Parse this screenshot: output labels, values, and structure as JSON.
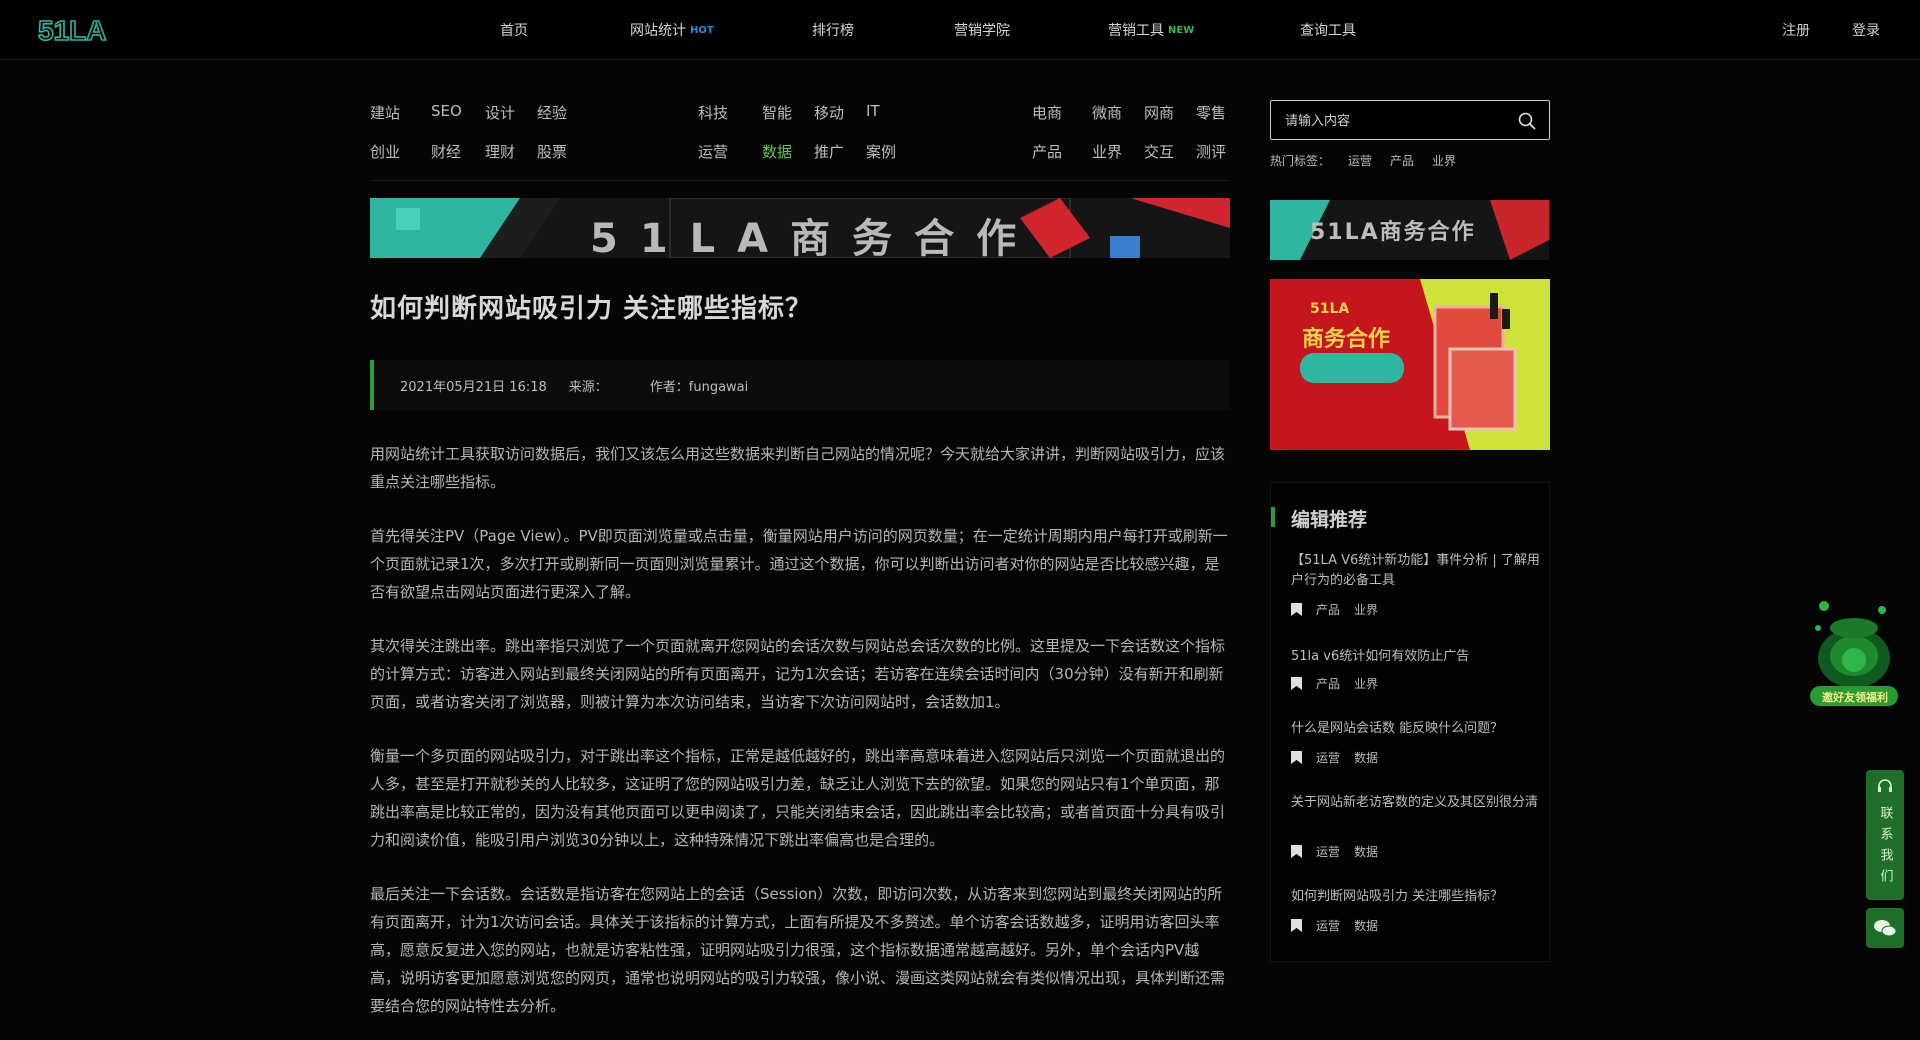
{
  "header": {
    "logo_text": "51LA",
    "nav": [
      {
        "label": "首页",
        "badge": ""
      },
      {
        "label": "网站统计",
        "badge": "HOT"
      },
      {
        "label": "排行榜",
        "badge": ""
      },
      {
        "label": "营销学院",
        "badge": ""
      },
      {
        "label": "营销工具",
        "badge": "NEW"
      },
      {
        "label": "查询工具",
        "badge": ""
      }
    ],
    "register": "注册",
    "login": "登录"
  },
  "categories": {
    "group1_row1": [
      "建站",
      "SEO",
      "设计",
      "经验"
    ],
    "group1_row2": [
      "创业",
      "财经",
      "理财",
      "股票"
    ],
    "group2_row1": [
      "科技",
      "智能",
      "移动",
      "IT"
    ],
    "group2_row2": [
      "运营",
      "数据",
      "推广",
      "案例"
    ],
    "group3_row1": [
      "电商",
      "微商",
      "网商",
      "零售"
    ],
    "group3_row2": [
      "产品",
      "业界",
      "交互",
      "测评"
    ]
  },
  "banner": {
    "text": "51LA商务合作"
  },
  "side_banner1": {
    "text": "51LA商务合作"
  },
  "side_banner2": {
    "logo": "51LA",
    "title": "商务合作"
  },
  "article": {
    "title": "如何判断网站吸引力 关注哪些指标？",
    "date": "2021年05月21日 16:18",
    "source_label": "来源：",
    "author": "作者：fungawai",
    "paragraphs": [
      "用网站统计工具获取访问数据后，我们又该怎么用这些数据来判断自己网站的情况呢？今天就给大家讲讲，判断网站吸引力，应该重点关注哪些指标。",
      "首先得关注PV（Page View）。PV即页面浏览量或点击量，衡量网站用户访问的网页数量；在一定统计周期内用户每打开或刷新一个页面就记录1次，多次打开或刷新同一页面则浏览量累计。通过这个数据，你可以判断出访问者对你的网站是否比较感兴趣，是否有欲望点击网站页面进行更深入了解。",
      "其次得关注跳出率。跳出率指只浏览了一个页面就离开您网站的会话次数与网站总会话次数的比例。这里提及一下会话数这个指标的计算方式：访客进入网站到最终关闭网站的所有页面离开，记为1次会话；若访客在连续会话时间内（30分钟）没有新开和刷新页面，或者访客关闭了浏览器，则被计算为本次访问结束，当访客下次访问网站时，会话数加1。",
      "衡量一个多页面的网站吸引力，对于跳出率这个指标，正常是越低越好的，跳出率高意味着进入您网站后只浏览一个页面就退出的人多，甚至是打开就秒关的人比较多，这证明了您的网站吸引力差，缺乏让人浏览下去的欲望。如果您的网站只有1个单页面，那跳出率高是比较正常的，因为没有其他页面可以更申阅读了，只能关闭结束会话，因此跳出率会比较高；或者首页面十分具有吸引力和阅读价值，能吸引用户浏览30分钟以上，这种特殊情况下跳出率偏高也是合理的。",
      "最后关注一下会话数。会话数是指访客在您网站上的会话（Session）次数，即访问次数，从访客来到您网站到最终关闭网站的所有页面离开，计为1次访问会话。具体关于该指标的计算方式，上面有所提及不多赘述。单个访客会话数越多，证明用访客回头率高，愿意反复进入您的网站，也就是访客粘性强，证明网站吸引力很强，这个指标数据通常越高越好。另外，单个会话内PV越高，说明访客更加愿意浏览您的网页，通常也说明网站的吸引力较强，像小说、漫画这类网站就会有类似情况出现，具体判断还需要结合您的网站特性去分析。"
    ]
  },
  "search": {
    "placeholder": "请输入内容",
    "hot_label": "热门标签：",
    "hot_tags": [
      "运营",
      "产品",
      "业界"
    ]
  },
  "recommend": {
    "title": "编辑推荐",
    "items": [
      {
        "title": "【51LA V6统计新功能】事件分析 | 了解用户行为的必备工具",
        "tags": [
          "产品",
          "业界"
        ]
      },
      {
        "title": "51la v6统计如何有效防止广告",
        "tags": [
          "产品",
          "业界"
        ]
      },
      {
        "title": "什么是网站会话数 能反映什么问题？",
        "tags": [
          "运营",
          "数据"
        ]
      },
      {
        "title": "关于网站新老访客数的定义及其区别很分清",
        "tags": [
          "运营",
          "数据"
        ]
      },
      {
        "title": "如何判断网站吸引力 关注哪些指标？",
        "tags": [
          "运营",
          "数据"
        ]
      }
    ]
  },
  "floating": {
    "mascot_label": "邀好友领福利",
    "side_label": "联系我们"
  }
}
